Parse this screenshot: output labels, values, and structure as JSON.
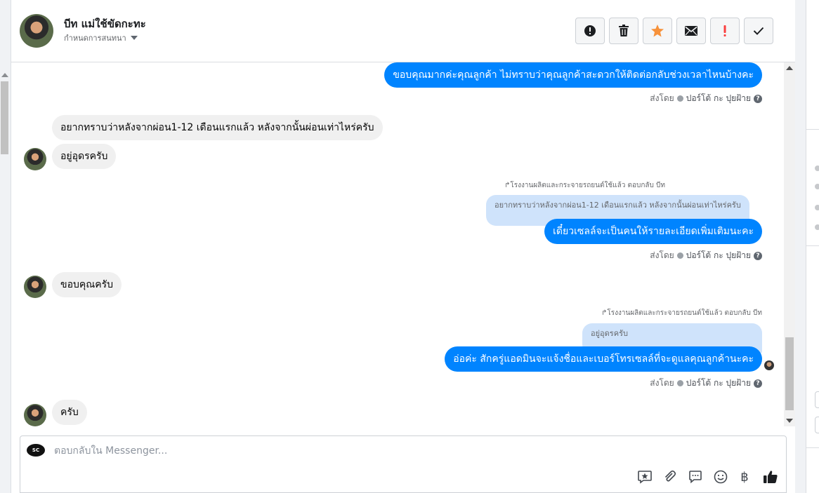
{
  "header": {
    "contact_name": "บีท แม่ใช้ขัดกะทะ",
    "assign_label": "กำหนดการสนทนา",
    "buttons": [
      {
        "name": "report-spam-button",
        "icon": "alert-circle-icon"
      },
      {
        "name": "delete-button",
        "icon": "trash-icon"
      },
      {
        "name": "star-button",
        "icon": "star-icon",
        "color": "#f7923b"
      },
      {
        "name": "mark-unread-button",
        "icon": "envelope-icon"
      },
      {
        "name": "follow-up-button",
        "icon": "exclamation-icon",
        "color": "#fa3e3e"
      },
      {
        "name": "mark-done-button",
        "icon": "check-icon"
      }
    ]
  },
  "messages": {
    "m1_out": "ขอบคุณมากค่ะคุณลูกค้า ไม่ทราบว่าคุณลูกค้าสะดวกให้ติดต่อกลับช่วงเวลาไหนบ้างคะ",
    "sent_by_label": "ส่งโดย",
    "sent_by_name": "ปอร์โต้ กะ ปุยฝ้าย",
    "help": "?",
    "m2_in": "อยากทราบว่าหลังจากผ่อน1-12 เดือนแรกแล้ว หลังจากนั้นผ่อนเท่าไหร่ครับ",
    "m3_in": "อยู่อุดรครับ",
    "reply1_meta": "โรงงานผลิตและกระจายรถยนต์ใช้แล้ว ตอบกลับ บีท",
    "reply1_quote": "อยากทราบว่าหลังจากผ่อน1-12 เดือนแรกแล้ว หลังจากนั้นผ่อนเท่าไหร่ครับ",
    "reply1_text": "เดี๋ยวเซลล์จะเป็นคนให้รายละเอียดเพิ่มเติมนะคะ",
    "m4_in": "ขอบคุณครับ",
    "reply2_meta": "โรงงานผลิตและกระจายรถยนต์ใช้แล้ว ตอบกลับ บีท",
    "reply2_quote": "อยู่อุดรครับ",
    "reply2_text": "อ่อค่ะ สักครู่แอดมินจะแจ้งชื่อและเบอร์โทรเซลล์ที่จะดูแลคุณลูกค้านะคะ",
    "m5_in": "ครับ"
  },
  "composer": {
    "placeholder": "ตอบกลับใน Messenger...",
    "page_logo_text": "SC",
    "icons": [
      "saved-reply-icon",
      "attachment-icon",
      "chat-bubble-icon",
      "emoji-icon",
      "baht-payment-icon",
      "thumbs-up-icon"
    ],
    "baht_symbol": "฿"
  },
  "colors": {
    "outgoing_bubble": "#0084ff",
    "incoming_bubble": "#f0f0f0",
    "quote_bubble": "#cfe3fb"
  }
}
